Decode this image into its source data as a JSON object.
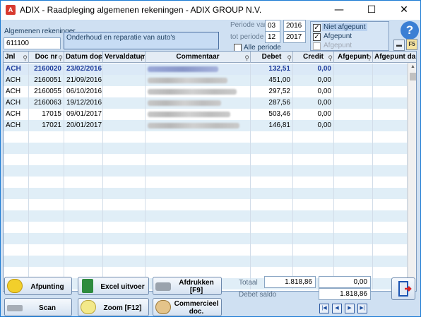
{
  "window": {
    "title": "ADIX - Raadpleging algemenen rekeningen - ADIX GROUP N.V.",
    "app_icon": "A",
    "minimize": "—",
    "maximize": "☐",
    "close": "✕"
  },
  "filters": {
    "account_label": "Algemenen rekeninger",
    "account_value": "611100",
    "account_description": "Onderhoud en reparatie van auto's",
    "period_from_label": "Periode van",
    "period_from_month": "03",
    "period_from_year": "2016",
    "period_to_label": "tot periode",
    "period_to_month": "12",
    "period_to_year": "2017",
    "all_period_label": "Alle periode",
    "all_period_checked": false,
    "not_reconciled_label": "Niet afgepunt",
    "not_reconciled_checked": true,
    "reconciled_label": "Afgepunt",
    "reconciled_checked": true,
    "reconciled2_label": "Afgepunt",
    "reconciled2_checked": false,
    "help_icon": "?",
    "f5_label": "F5"
  },
  "grid": {
    "columns": [
      "Jnl",
      "Doc nr",
      "Datum doc",
      "Vervaldatum",
      "Commentaar",
      "Debet",
      "Credit",
      "Afgepunt",
      "Afgepunt da"
    ],
    "rows": [
      {
        "jnl": "ACH",
        "doc": "2160020",
        "date": "23/02/2016",
        "due": "",
        "debet": "132,51",
        "credit": "0,00",
        "selected": true
      },
      {
        "jnl": "ACH",
        "doc": "2160051",
        "date": "21/09/2016",
        "due": "",
        "debet": "451,00",
        "credit": "0,00",
        "selected": false
      },
      {
        "jnl": "ACH",
        "doc": "2160055",
        "date": "06/10/2016",
        "due": "",
        "debet": "297,52",
        "credit": "0,00",
        "selected": false
      },
      {
        "jnl": "ACH",
        "doc": "2160063",
        "date": "19/12/2016",
        "due": "",
        "debet": "287,56",
        "credit": "0,00",
        "selected": false
      },
      {
        "jnl": "ACH",
        "doc": "17015",
        "date": "09/01/2017",
        "due": "",
        "debet": "503,46",
        "credit": "0,00",
        "selected": false
      },
      {
        "jnl": "ACH",
        "doc": "17021",
        "date": "20/01/2017",
        "due": "",
        "debet": "146,81",
        "credit": "0,00",
        "selected": false
      }
    ]
  },
  "buttons": {
    "afpunting": "Afpunting",
    "excel": "Excel uitvoer",
    "afdrukken": "Afdrukken [F9]",
    "scan": "Scan",
    "zoom": "Zoom [F12]",
    "commercieel": "Commercieel doc."
  },
  "totals": {
    "totaal_label": "Totaal",
    "totaal_debet": "1.818,86",
    "totaal_credit": "0,00",
    "saldo_label": "Debet saldo",
    "saldo_value": "1.818,86"
  },
  "nav": {
    "first": "|◀",
    "prev": "◀",
    "next": "▶",
    "last": "▶|"
  }
}
